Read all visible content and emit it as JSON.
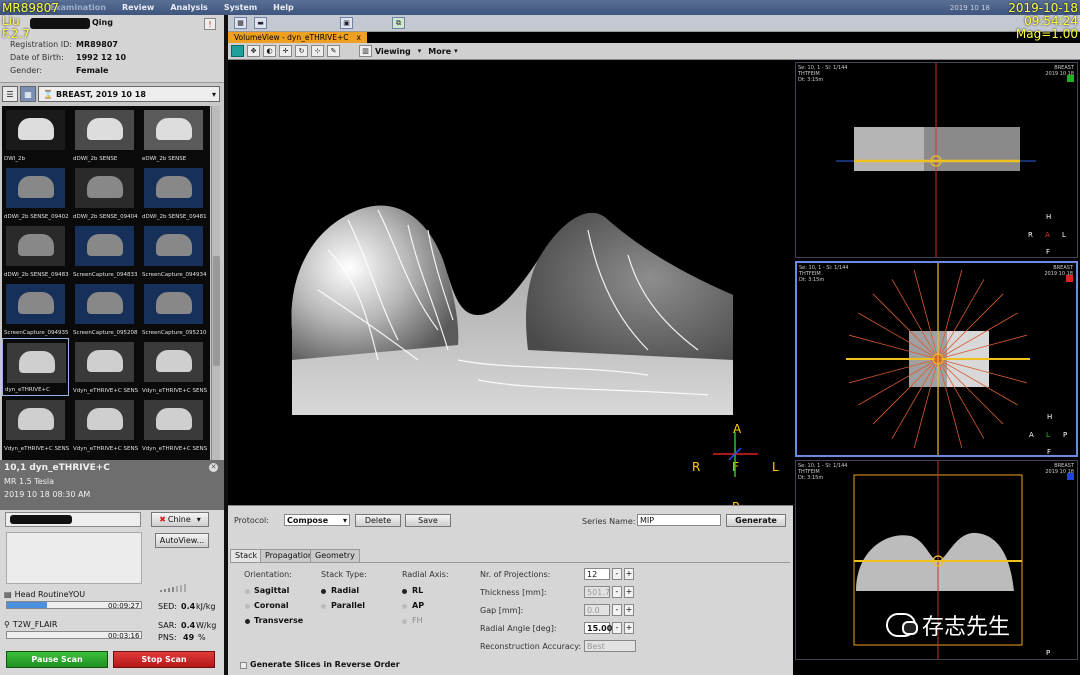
{
  "menubar": {
    "items": [
      "Examination",
      "Review",
      "Analysis",
      "System",
      "Help"
    ],
    "date": "2019 10 18"
  },
  "overlay": {
    "left_top": "MR89807",
    "left_line2": "Liu",
    "left_line3": "F.2.7",
    "right_date": "2019-10-18",
    "right_time": "09:54:24",
    "right_mag": "Mag=1.00"
  },
  "patient": {
    "name_suffix": "Qing",
    "fields": [
      {
        "k": "Registration ID:",
        "v": "MR89807"
      },
      {
        "k": "Date of Birth:",
        "v": "1992 12 10"
      },
      {
        "k": "Gender:",
        "v": "Female"
      }
    ]
  },
  "study": {
    "label": "BREAST, 2019 10 18"
  },
  "thumbnails": [
    {
      "label": "DWI_2b"
    },
    {
      "label": "dDWI_2b SENSE"
    },
    {
      "label": "eDWI_2b SENSE"
    },
    {
      "label": "dDWI_2b SENSE_09402"
    },
    {
      "label": "dDWI_2b SENSE_09404"
    },
    {
      "label": "dDWI_2b SENSE_09481"
    },
    {
      "label": "dDWI_2b SENSE_09483"
    },
    {
      "label": "ScreenCapture_094833"
    },
    {
      "label": "ScreenCapture_094934"
    },
    {
      "label": "ScreenCapture_094935"
    },
    {
      "label": "ScreenCapture_095208"
    },
    {
      "label": "ScreenCapture_095210"
    },
    {
      "label": "dyn_eTHRIVE+C"
    },
    {
      "label": "Vdyn_eTHRIVE+C SENS"
    },
    {
      "label": "Vdyn_eTHRIVE+C SENS"
    },
    {
      "label": "Vdyn_eTHRIVE+C SENS"
    },
    {
      "label": "Vdyn_eTHRIVE+C SENS"
    },
    {
      "label": "Vdyn_eTHRIVE+C SENS"
    }
  ],
  "series": {
    "title": "10,1 dyn_eTHRIVE+C",
    "line2": "MR  1.5 Tesla",
    "line3": "2019 10 18   08:30 AM"
  },
  "scan": {
    "language": "Chine",
    "autoview": "AutoView...",
    "items": [
      {
        "name": "Head RoutineYOU",
        "time": "00:09:27",
        "progress": 0.3
      },
      {
        "name": "T2W_FLAIR",
        "time": "00:03:16",
        "progress": 0
      }
    ],
    "sed_label": "SED:",
    "sed_value": "0.4",
    "sed_unit": "kJ/kg",
    "sar_label": "SAR:",
    "sar_value": "0.4",
    "sar_unit": "W/kg",
    "pns_label": "PNS:",
    "pns_value": "49",
    "pns_unit": "%",
    "pause": "Pause Scan",
    "stop": "Stop Scan"
  },
  "tab": {
    "label": "VolumeView - dyn_eTHRIVE+C",
    "close": "x"
  },
  "toolbar": {
    "viewing": "Viewing",
    "more": "More"
  },
  "main_orient": {
    "top": "A",
    "left": "R",
    "center": "F",
    "right": "L",
    "bottom": "P"
  },
  "sideviews": [
    {
      "meta": "Se: 10, 1 - Sl: 1/144\nTHTFEIM\nDt: 3:15m",
      "meta2": "BREAST\n2019 10 18",
      "color": "#20b020",
      "o": {
        "top": "H",
        "left": "R",
        "center": "A",
        "right": "L",
        "bottom": "F"
      }
    },
    {
      "meta": "Se: 10, 1 - Sl: 1/144\nTHTFEIM\nDt: 3:15m",
      "meta2": "BREAST\n2019 10 18",
      "color": "#e02020",
      "o": {
        "top": "H",
        "left": "A",
        "center": "L",
        "right": "P",
        "bottom": "F"
      }
    },
    {
      "meta": "Se: 10, 1 - Sl: 1/144\nTHTFEIM\nDt: 3:15m",
      "meta2": "BREAST\n2019 10 18",
      "color": "#2040e0",
      "o": {
        "top": "",
        "left": "",
        "center": "",
        "right": "",
        "bottom": "P"
      }
    }
  ],
  "panel": {
    "protocol_label": "Protocol:",
    "protocol_value": "Compose",
    "delete": "Delete",
    "save": "Save",
    "series_name_label": "Series Name:",
    "series_name_value": "MIP",
    "generate": "Generate",
    "tabs": [
      "Stack",
      "Propagation",
      "Geometry"
    ],
    "orientation_label": "Orientation:",
    "orientation": [
      "Sagittal",
      "Coronal",
      "Transverse"
    ],
    "stack_type_label": "Stack Type:",
    "stack_type": [
      "Radial",
      "Parallel"
    ],
    "radial_axis_label": "Radial Axis:",
    "radial_axis": [
      "RL",
      "AP",
      "FH"
    ],
    "nr_proj_label": "Nr. of Projections:",
    "nr_proj_value": "12",
    "thickness_label": "Thickness [mm]:",
    "thickness_value": "501.7",
    "gap_label": "Gap [mm]:",
    "gap_value": "0.0",
    "angle_label": "Radial Angle [deg]:",
    "angle_value": "15.00",
    "recon_label": "Reconstruction Accuracy:",
    "recon_value": "Best",
    "reverse_label": "Generate Slices in Reverse Order"
  },
  "watermark": {
    "text": "存志先生"
  }
}
